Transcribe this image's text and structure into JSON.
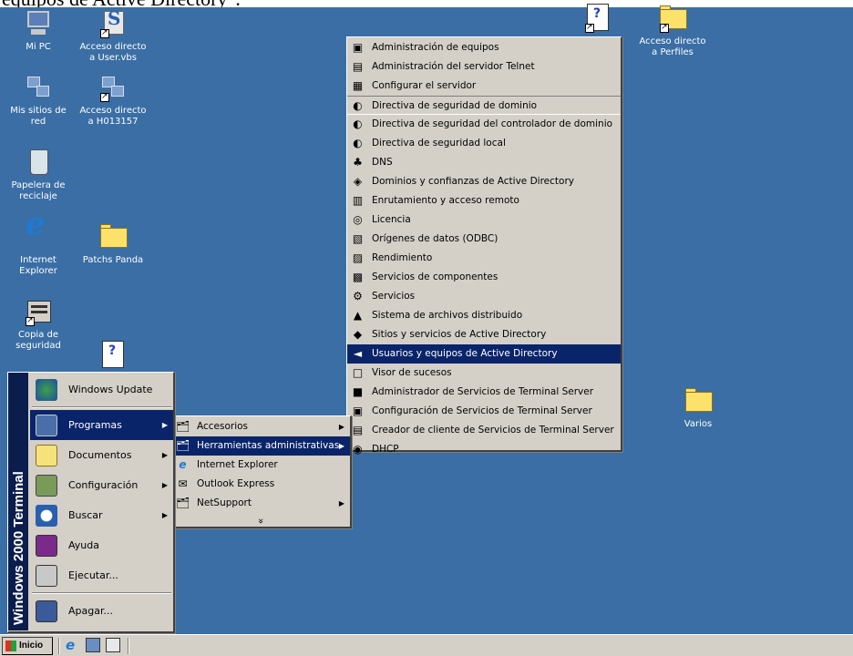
{
  "heading_fragment": "equipos de Active Directory\".",
  "colors": {
    "desktop": "#3a6ea5",
    "menu_bg": "#d4d0c8",
    "selection": "#0a246a",
    "banner": "#0b1d4c"
  },
  "desktop": {
    "icons": [
      {
        "name": "mi-pc",
        "label": "Mi PC",
        "icon": "computer-icon"
      },
      {
        "name": "acceso-user",
        "label": "Acceso directo\na User.vbs",
        "icon": "script-icon"
      },
      {
        "name": "mis-sitios",
        "label": "Mis sitios de\nred",
        "icon": "network-icon"
      },
      {
        "name": "acceso-h013157",
        "label": "Acceso directo\na H013157",
        "icon": "network-icon"
      },
      {
        "name": "papelera",
        "label": "Papelera de\nreciclaje",
        "icon": "recycle-bin-icon"
      },
      {
        "name": "internet-explorer",
        "label": "Internet\nExplorer",
        "icon": "ie-icon"
      },
      {
        "name": "patchs-panda",
        "label": "Patchs Panda",
        "icon": "folder-icon"
      },
      {
        "name": "copia-seguridad",
        "label": "Copia de\nseguridad",
        "icon": "backup-icon"
      },
      {
        "name": "acceso-perfiles",
        "label": "Acceso directo\na Perfiles",
        "icon": "folder-icon"
      },
      {
        "name": "varios",
        "label": "Varios",
        "icon": "folder-icon"
      }
    ]
  },
  "start_menu": {
    "banner": "Windows 2000 Terminal",
    "items": [
      {
        "label": "Windows Update",
        "icon": "windows-update-icon"
      },
      {
        "label": "Programas",
        "icon": "programs-icon",
        "arrow": true,
        "selected": true
      },
      {
        "label": "Documentos",
        "icon": "documents-icon",
        "arrow": true
      },
      {
        "label": "Configuración",
        "icon": "settings-icon",
        "arrow": true
      },
      {
        "label": "Buscar",
        "icon": "search-icon",
        "arrow": true
      },
      {
        "label": "Ayuda",
        "icon": "help-icon"
      },
      {
        "label": "Ejecutar...",
        "icon": "run-icon"
      },
      {
        "label": "Apagar...",
        "icon": "shutdown-icon"
      }
    ]
  },
  "programs_menu": {
    "items": [
      {
        "label": "Accesorios",
        "arrow": true
      },
      {
        "label": "Herramientas administrativas",
        "arrow": true,
        "selected": true
      },
      {
        "label": "Internet Explorer"
      },
      {
        "label": "Outlook Express"
      },
      {
        "label": "NetSupport",
        "arrow": true
      }
    ],
    "more": "»"
  },
  "admin_menu": {
    "items": [
      "Administración de equipos",
      "Administración del servidor Telnet",
      "Configurar el servidor",
      "Directiva de seguridad de dominio",
      "Directiva de seguridad del controlador de dominio",
      "Directiva de seguridad local",
      "DNS",
      "Dominios y confianzas de Active Directory",
      "Enrutamiento y acceso remoto",
      "Licencia",
      "Orígenes de datos (ODBC)",
      "Rendimiento",
      "Servicios de componentes",
      "Servicios",
      "Sistema de archivos distribuido",
      "Sitios y servicios de Active Directory",
      "Usuarios y equipos de Active Directory",
      "Visor de sucesos",
      "Administrador de Servicios de Terminal Server",
      "Configuración de Servicios de Terminal Server",
      "Creador de cliente de Servicios de Terminal Server",
      "DHCP"
    ],
    "selected_index": 16
  },
  "taskbar": {
    "start_label": "Inicio"
  }
}
